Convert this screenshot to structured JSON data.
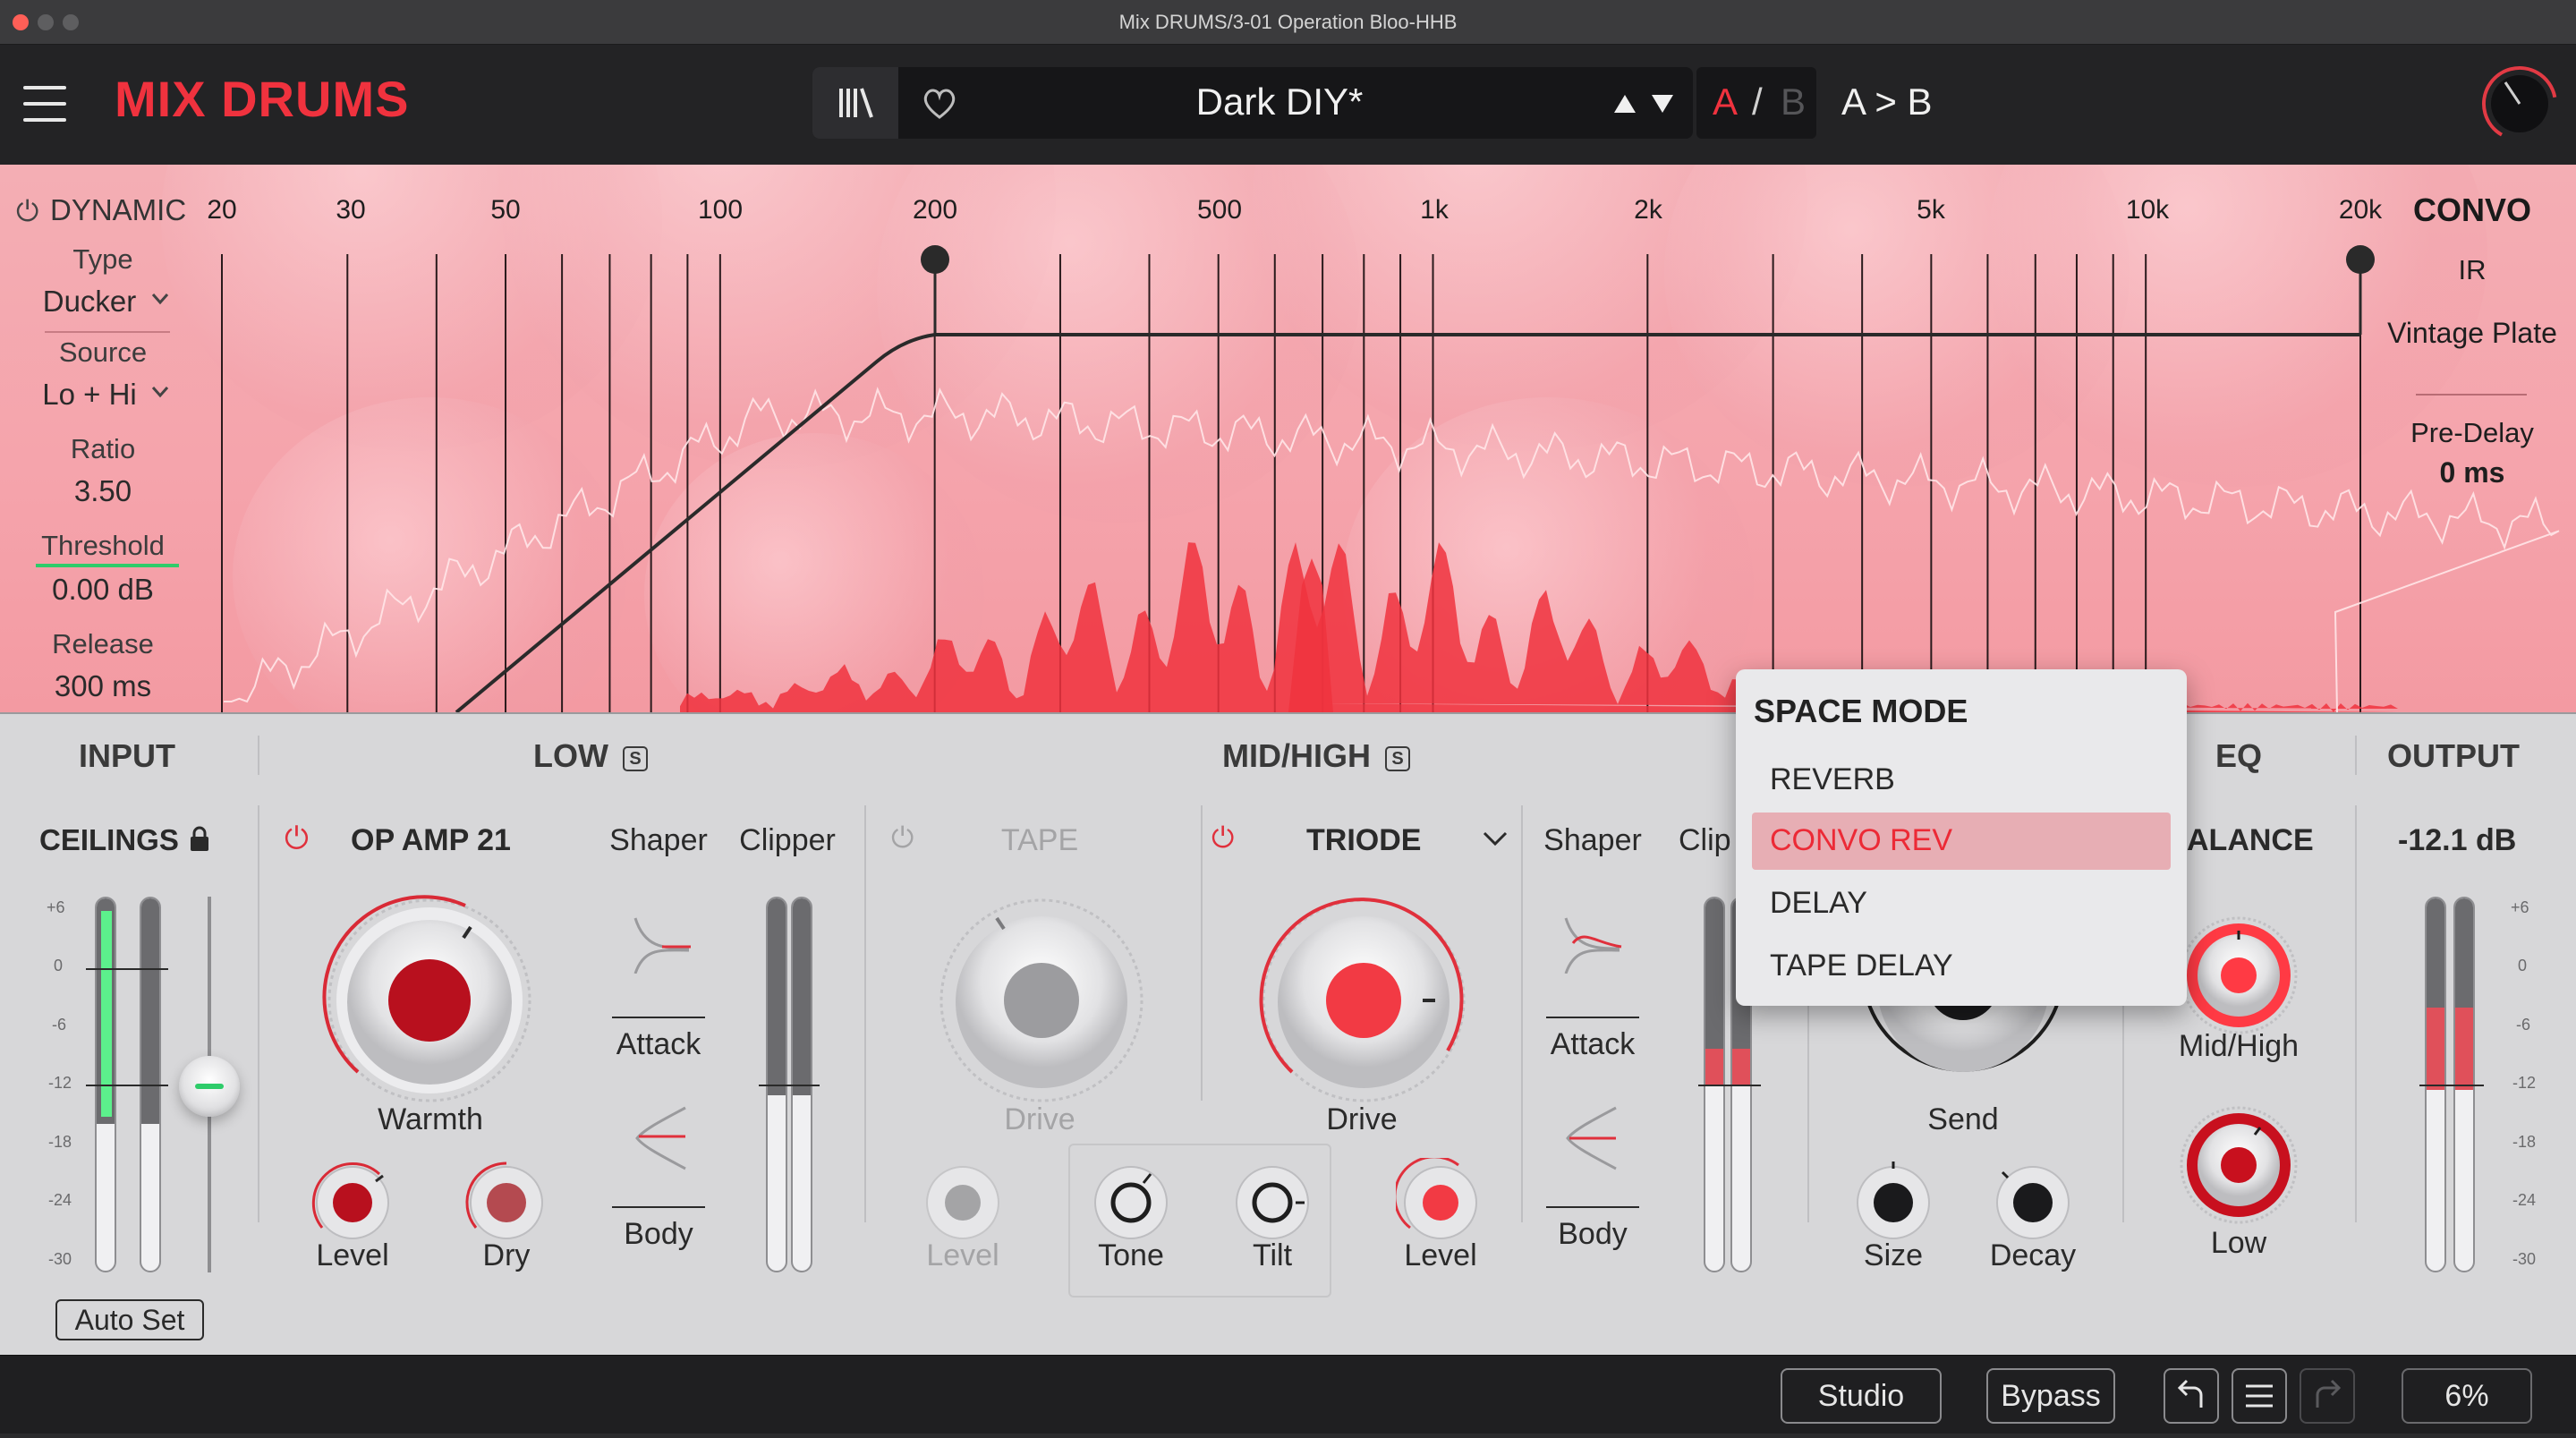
{
  "window": {
    "title": "Mix DRUMS/3-01 Operation Bloo-HHB"
  },
  "header": {
    "logo": "MIX DRUMS",
    "preset_name": "Dark DIY*",
    "ab_a": "A",
    "ab_sep": "/",
    "ab_b": "B",
    "copy_ab": "A > B"
  },
  "graph": {
    "freq_labels": [
      "20",
      "30",
      "50",
      "100",
      "200",
      "500",
      "1k",
      "2k",
      "5k",
      "10k",
      "20k"
    ],
    "dynamic": {
      "title": "DYNAMIC",
      "type_label": "Type",
      "type_value": "Ducker",
      "source_label": "Source",
      "source_value": "Lo + Hi",
      "ratio_label": "Ratio",
      "ratio_value": "3.50",
      "threshold_label": "Threshold",
      "threshold_value": "0.00 dB",
      "release_label": "Release",
      "release_value": "300 ms"
    },
    "convo": {
      "title": "CONVO",
      "ir_label": "IR",
      "ir_value": "Vintage Plate",
      "predelay_label": "Pre-Delay",
      "predelay_value": "0 ms"
    }
  },
  "sections": {
    "input": "INPUT",
    "low": "LOW",
    "midhigh": "MID/HIGH",
    "eq": "EQ",
    "output": "OUTPUT",
    "solo_glyph": "S"
  },
  "input": {
    "ceilings": "CEILINGS",
    "auto_set": "Auto Set",
    "scale": [
      "+6",
      "0",
      "-6",
      "-12",
      "-18",
      "-24",
      "-30"
    ]
  },
  "low": {
    "module": "OP AMP 21",
    "shaper": "Shaper",
    "clipper": "Clipper",
    "warmth": "Warmth",
    "level": "Level",
    "dry": "Dry",
    "attack": "Attack",
    "body": "Body"
  },
  "midhigh": {
    "tape": "TAPE",
    "triode": "TRIODE",
    "shaper": "Shaper",
    "clip": "Clip",
    "drive_tape": "Drive",
    "drive_triode": "Drive",
    "level_tape": "Level",
    "tone": "Tone",
    "tilt": "Tilt",
    "level_triode": "Level",
    "attack": "Attack",
    "body": "Body"
  },
  "space": {
    "send": "Send",
    "size": "Size",
    "decay": "Decay"
  },
  "eq": {
    "balance": "ALANCE",
    "midhigh": "Mid/High",
    "low": "Low"
  },
  "output": {
    "value": "-12.1 dB",
    "scale": [
      "+6",
      "0",
      "-6",
      "-12",
      "-18",
      "-24",
      "-30"
    ]
  },
  "space_menu": {
    "title": "SPACE MODE",
    "items": [
      "REVERB",
      "CONVO REV",
      "DELAY",
      "TAPE DELAY"
    ],
    "selected": "CONVO REV"
  },
  "footer": {
    "studio": "Studio",
    "bypass": "Bypass",
    "cpu": "6%"
  },
  "colors": {
    "accent": "#f0323e",
    "green": "#3ee37a"
  }
}
